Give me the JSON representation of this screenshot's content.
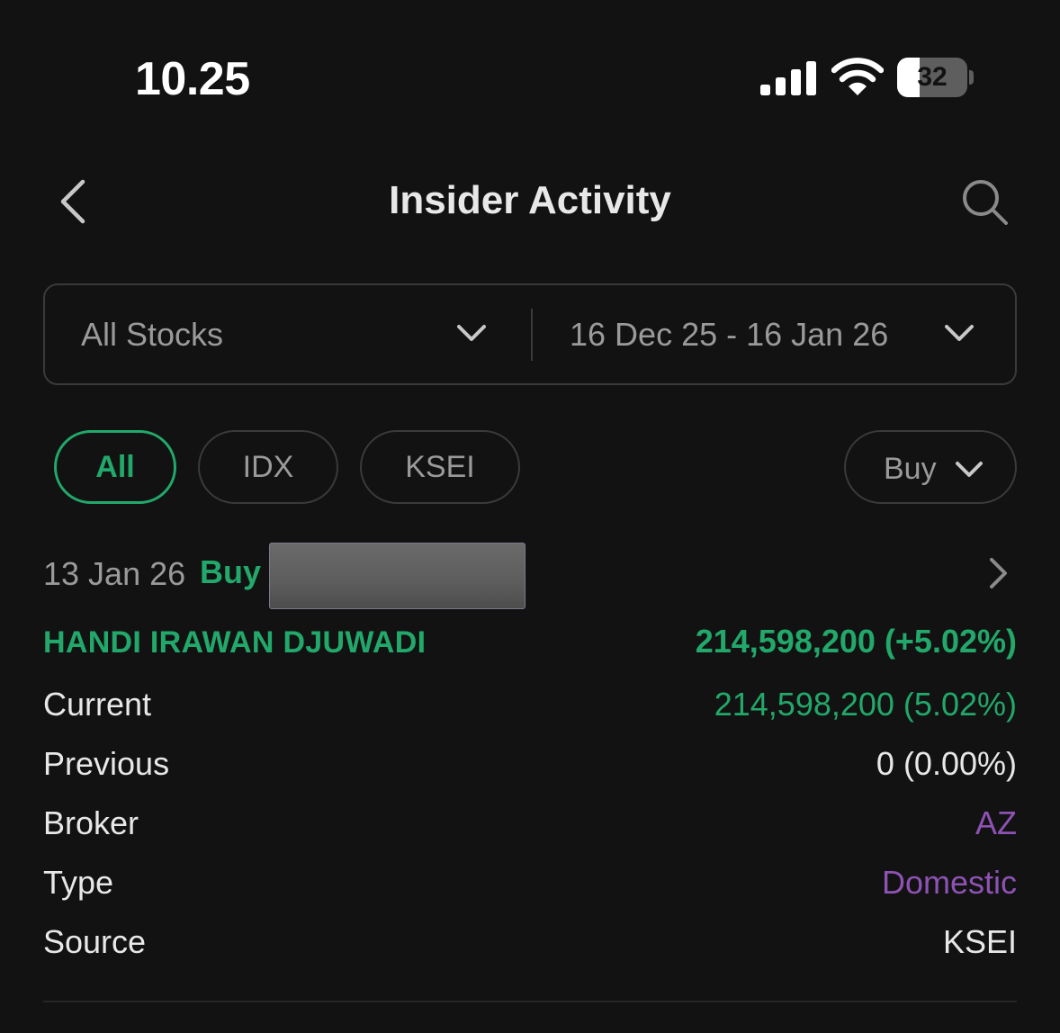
{
  "status_bar": {
    "time": "10.25",
    "battery_level": "32",
    "battery_fraction": 0.32
  },
  "header": {
    "title": "Insider Activity",
    "back_icon": "chevron-left-icon",
    "search_icon": "search-icon"
  },
  "filters": {
    "stock_select": "All Stocks",
    "date_range": "16 Dec 25 - 16 Jan 26"
  },
  "chips": {
    "items": [
      "All",
      "IDX",
      "KSEI"
    ],
    "active": "All",
    "type_select": "Buy"
  },
  "activity": {
    "date": "13 Jan 26",
    "action": "Buy",
    "name": "HANDI IRAWAN DJUWADI",
    "total": "214,598,200 (+5.02%)",
    "rows": [
      {
        "label": "Current",
        "value": "214,598,200 (5.02%)"
      },
      {
        "label": "Previous",
        "value": "0 (0.00%)"
      },
      {
        "label": "Broker",
        "value": "AZ"
      },
      {
        "label": "Type",
        "value": "Domestic"
      },
      {
        "label": "Source",
        "value": "KSEI"
      }
    ]
  },
  "colors": {
    "background": "#121212",
    "accent_green": "#22a86a",
    "accent_purple": "#8e52b4",
    "muted_text": "#9a9a9a",
    "border": "#3a3a3a"
  }
}
